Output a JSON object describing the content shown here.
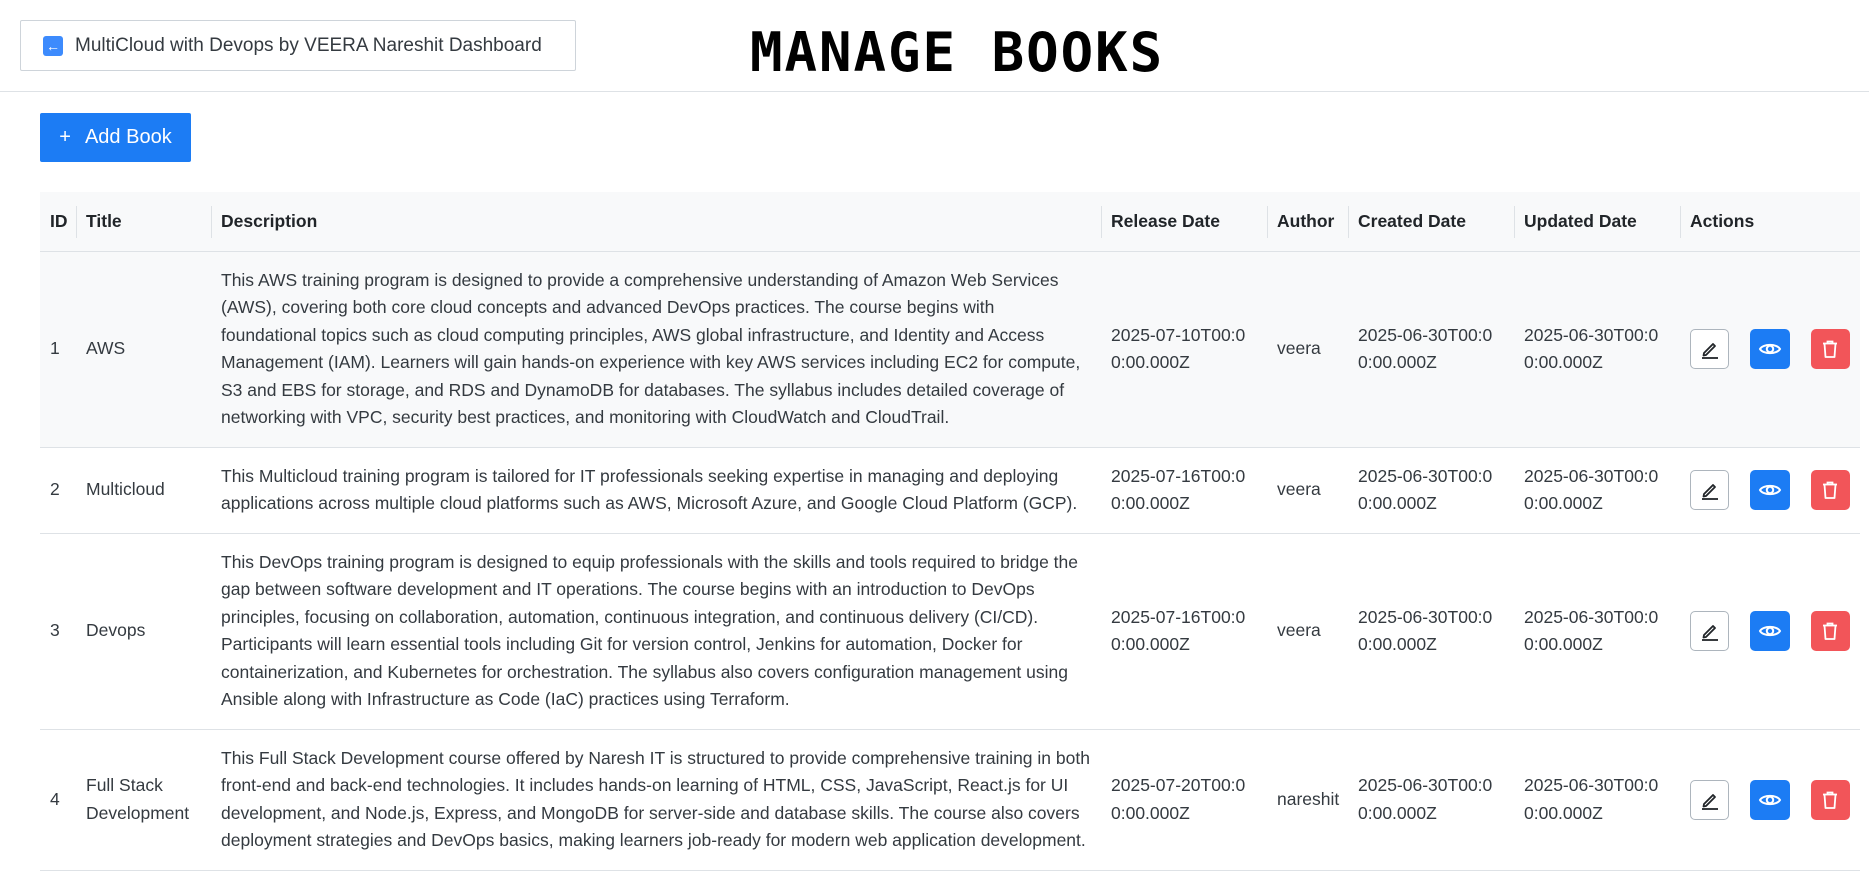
{
  "header": {
    "back_label": "MultiCloud with Devops by VEERA Nareshit Dashboard",
    "title": "MANAGE BOOKS"
  },
  "toolbar": {
    "add_label": "Add Book",
    "add_symbol": "+"
  },
  "table": {
    "columns": [
      "ID",
      "Title",
      "Description",
      "Release Date",
      "Author",
      "Created Date",
      "Updated Date",
      "Actions"
    ],
    "rows": [
      {
        "id": "1",
        "title": "AWS",
        "description": "This AWS training program is designed to provide a comprehensive understanding of Amazon Web Services (AWS), covering both core cloud concepts and advanced DevOps practices. The course begins with foundational topics such as cloud computing principles, AWS global infrastructure, and Identity and Access Management (IAM). Learners will gain hands-on experience with key AWS services including EC2 for compute, S3 and EBS for storage, and RDS and DynamoDB for databases. The syllabus includes detailed coverage of networking with VPC, security best practices, and monitoring with CloudWatch and CloudTrail.",
        "release_date": "2025-07-10T00:00:00.000Z",
        "author": "veera",
        "created_date": "2025-06-30T00:00:00.000Z",
        "updated_date": "2025-06-30T00:00:00.000Z"
      },
      {
        "id": "2",
        "title": "Multicloud",
        "description": "This Multicloud training program is tailored for IT professionals seeking expertise in managing and deploying applications across multiple cloud platforms such as AWS, Microsoft Azure, and Google Cloud Platform (GCP).",
        "release_date": "2025-07-16T00:00:00.000Z",
        "author": "veera",
        "created_date": "2025-06-30T00:00:00.000Z",
        "updated_date": "2025-06-30T00:00:00.000Z"
      },
      {
        "id": "3",
        "title": "Devops",
        "description": "This DevOps training program is designed to equip professionals with the skills and tools required to bridge the gap between software development and IT operations. The course begins with an introduction to DevOps principles, focusing on collaboration, automation, continuous integration, and continuous delivery (CI/CD). Participants will learn essential tools including Git for version control, Jenkins for automation, Docker for containerization, and Kubernetes for orchestration. The syllabus also covers configuration management using Ansible along with Infrastructure as Code (IaC) practices using Terraform.",
        "release_date": "2025-07-16T00:00:00.000Z",
        "author": "veera",
        "created_date": "2025-06-30T00:00:00.000Z",
        "updated_date": "2025-06-30T00:00:00.000Z"
      },
      {
        "id": "4",
        "title": "Full Stack Development",
        "description": "This Full Stack Development course offered by Naresh IT is structured to provide comprehensive training in both front-end and back-end technologies. It includes hands-on learning of HTML, CSS, JavaScript, React.js for UI development, and Node.js, Express, and MongoDB for server-side and database skills. The course also covers deployment strategies and DevOps basics, making learners job-ready for modern web application development.",
        "release_date": "2025-07-20T00:00:00.000Z",
        "author": "nareshit",
        "created_date": "2025-06-30T00:00:00.000Z",
        "updated_date": "2025-06-30T00:00:00.000Z"
      }
    ]
  },
  "icons": {
    "back": "back-arrow-icon",
    "edit": "pencil-icon",
    "view": "eye-icon",
    "delete": "trash-icon"
  },
  "colors": {
    "primary": "#1c7cf4",
    "danger": "#f25559",
    "header_bg": "#f8f9fa"
  }
}
